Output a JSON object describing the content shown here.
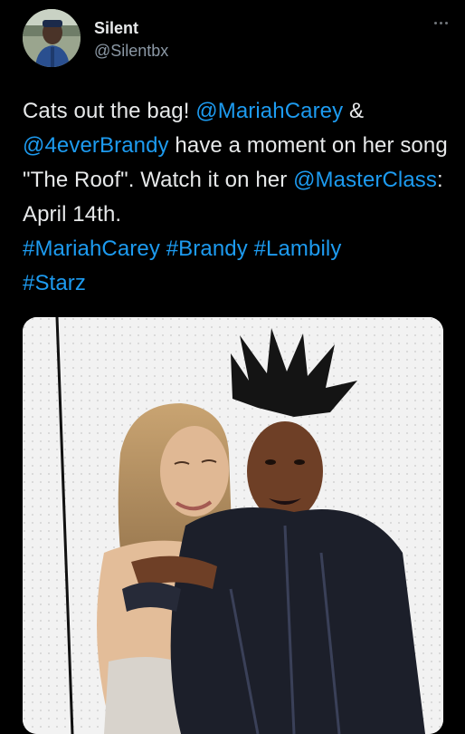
{
  "tweet": {
    "author": {
      "display_name": "Silent",
      "handle": "@Silentbx",
      "avatar_icon": "profile-avatar"
    },
    "more_icon": "more-horizontal-icon",
    "text": {
      "line1_plain": "Cats out the bag! ",
      "mention1": "@MariahCarey",
      "line1_tail": " &",
      "mention2": "@4everBrandy",
      "text2": " have a moment on her song \"The Roof\". Watch it on her ",
      "mention3": "@MasterClass",
      "text3": ": April 14th. ",
      "hashtag1": "#MariahCarey",
      "hashtag2": "#Brandy",
      "hashtag3": "#Lambily",
      "hashtag4": "#Starz"
    },
    "media": {
      "type": "photo"
    }
  },
  "colors": {
    "background": "#000000",
    "text": "#e7e9ea",
    "secondary": "#8b98a5",
    "link": "#1d9bf0"
  }
}
